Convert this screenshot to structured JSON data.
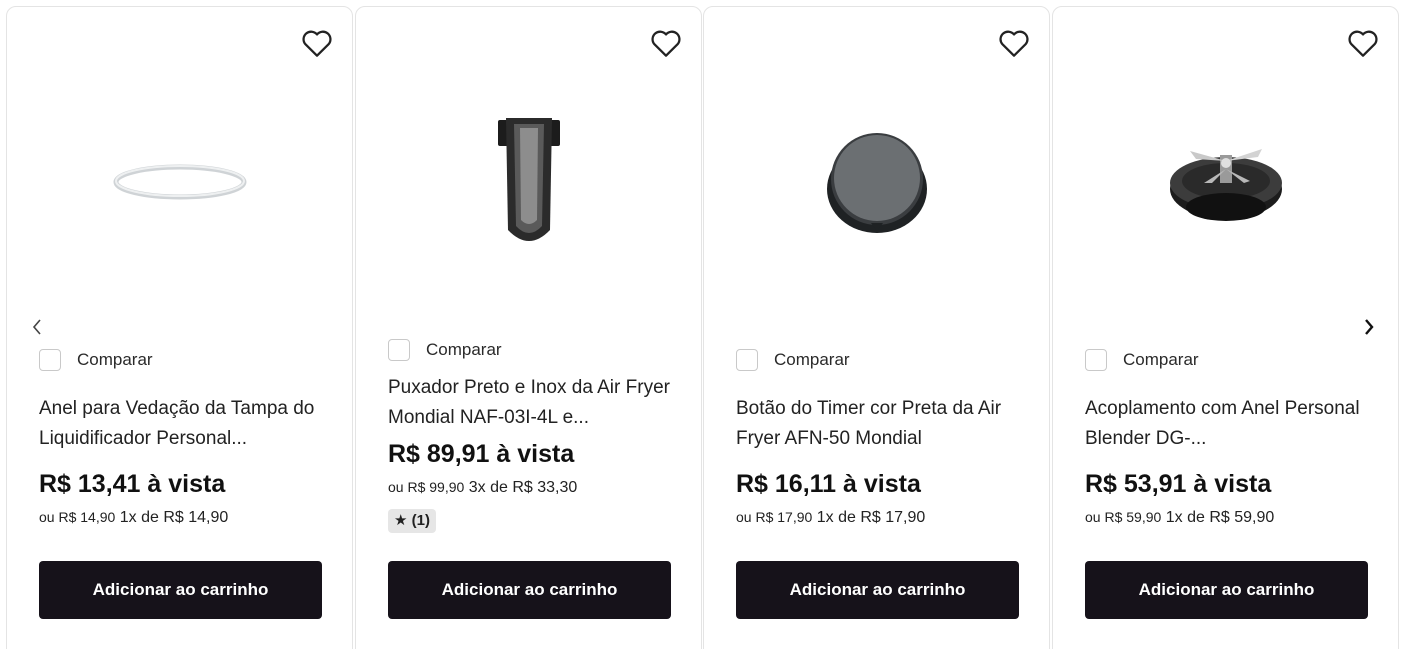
{
  "products": [
    {
      "compare_label": "Comparar",
      "title": "Anel para Vedação da Tampa do Liquidificador Personal...",
      "price": "R$ 13,41 à vista",
      "installment_prefix": "ou R$ 14,90",
      "installment_suffix": " 1x de R$ 14,90",
      "cart_label": "Adicionar ao carrinho",
      "image_icon": "rubber-ring"
    },
    {
      "compare_label": "Comparar",
      "title": "Puxador Preto e Inox da Air Fryer Mondial NAF-03I-4L e...",
      "price": "R$ 89,91 à vista",
      "installment_prefix": "ou R$ 99,90",
      "installment_suffix": " 3x de R$ 33,30",
      "rating": "★ (1)",
      "cart_label": "Adicionar ao carrinho",
      "image_icon": "handle"
    },
    {
      "compare_label": "Comparar",
      "title": "Botão do Timer cor Preta da Air Fryer AFN-50 Mondial",
      "price": "R$ 16,11 à vista",
      "installment_prefix": "ou R$ 17,90",
      "installment_suffix": " 1x de R$ 17,90",
      "cart_label": "Adicionar ao carrinho",
      "image_icon": "timer-knob"
    },
    {
      "compare_label": "Comparar",
      "title": "Acoplamento com Anel Personal Blender DG-...",
      "price": "R$ 53,91 à vista",
      "installment_prefix": "ou R$ 59,90",
      "installment_suffix": " 1x de R$ 59,90",
      "cart_label": "Adicionar ao carrinho",
      "image_icon": "blade-coupling"
    }
  ],
  "navigation": {
    "prev_icon": "chevron-left-icon",
    "next_icon": "chevron-right-icon"
  },
  "colors": {
    "button_bg": "#16121a",
    "button_text": "#ffffff",
    "rating_bg": "#e6e6e6"
  }
}
